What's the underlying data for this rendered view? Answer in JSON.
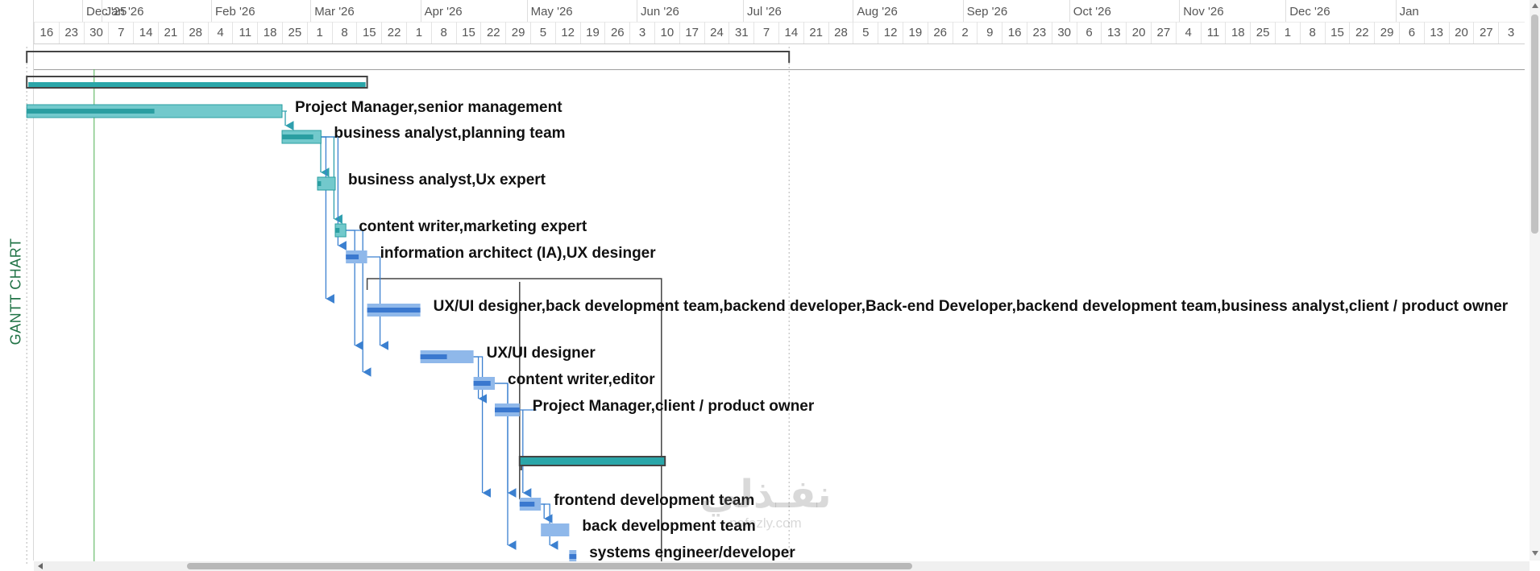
{
  "view": {
    "side_label": "GANTT CHART",
    "colors": {
      "summary_bar": "#2aa6a9",
      "teal_task": "#72c9cc",
      "teal_progress": "#2a9ea1",
      "blue_task": "#8fb8ea",
      "blue_progress": "#3a78cf",
      "link_teal": "#2e9fae",
      "link_blue": "#3b80d0",
      "summary_bracket": "#444444",
      "today_line": "#4caf50",
      "side_label": "#217346"
    }
  },
  "timescale": {
    "months": [
      "Dec '25",
      "Jan '26",
      "Feb '26",
      "Mar '26",
      "Apr '26",
      "May '26",
      "Jun '26",
      "Jul '26",
      "Aug '26",
      "Sep '26",
      "Oct '26",
      "Nov '26",
      "Dec '26",
      "Jan"
    ],
    "days": [
      "16",
      "23",
      "30",
      "7",
      "14",
      "21",
      "28",
      "4",
      "11",
      "18",
      "25",
      "1",
      "8",
      "15",
      "22",
      "1",
      "8",
      "15",
      "22",
      "29",
      "5",
      "12",
      "19",
      "26",
      "3",
      "10",
      "17",
      "24",
      "31",
      "7",
      "14",
      "21",
      "28",
      "5",
      "12",
      "19",
      "26",
      "2",
      "9",
      "16",
      "23",
      "30",
      "6",
      "13",
      "20",
      "27",
      "4",
      "11",
      "18",
      "25",
      "1",
      "8",
      "15",
      "22",
      "29",
      "6",
      "13",
      "20",
      "27",
      "3"
    ]
  },
  "tasks": [
    {
      "id": "summary-project",
      "type": "summary",
      "start": "2025-12-11",
      "end": "2026-03-17",
      "label": ""
    },
    {
      "id": "task-1",
      "type": "task",
      "color": "teal",
      "start": "2025-12-11",
      "end": "2026-02-21",
      "progress": 0.5,
      "label": "Project Manager,senior management"
    },
    {
      "id": "task-2",
      "type": "task",
      "color": "teal",
      "start": "2026-02-21",
      "end": "2026-03-04",
      "progress": 0.8,
      "label": "business analyst,planning team"
    },
    {
      "id": "task-3",
      "type": "task",
      "color": "teal",
      "start": "2026-03-03",
      "end": "2026-03-08",
      "progress": 0.2,
      "label": "business analyst,Ux expert"
    },
    {
      "id": "task-4",
      "type": "task",
      "color": "teal",
      "start": "2026-03-08",
      "end": "2026-03-11",
      "progress": 0.4,
      "label": "content writer,marketing expert"
    },
    {
      "id": "task-5",
      "type": "task",
      "color": "blue",
      "start": "2026-03-11",
      "end": "2026-03-17",
      "progress": 0.6,
      "label": "information architect (IA),UX desinger"
    },
    {
      "id": "task-6",
      "type": "task",
      "color": "blue",
      "start": "2026-03-17",
      "end": "2026-04-01",
      "progress": 1.0,
      "label": "UX/UI designer,back development team,backend developer,Back-end Developer,backend development team,business analyst,client / product owner"
    },
    {
      "id": "task-7",
      "type": "task",
      "color": "blue",
      "start": "2026-04-01",
      "end": "2026-04-16",
      "progress": 0.5,
      "label": "UX/UI designer"
    },
    {
      "id": "task-8",
      "type": "task",
      "color": "blue",
      "start": "2026-04-16",
      "end": "2026-04-22",
      "progress": 0.8,
      "label": "content writer,editor"
    },
    {
      "id": "task-9",
      "type": "task",
      "color": "blue",
      "start": "2026-04-22",
      "end": "2026-04-29",
      "progress": 1.0,
      "label": "Project Manager,client / product owner"
    },
    {
      "id": "summary-development",
      "type": "summary",
      "start": "2026-04-29",
      "end": "2026-06-09",
      "label": ""
    },
    {
      "id": "task-10",
      "type": "task",
      "color": "blue",
      "start": "2026-04-29",
      "end": "2026-05-05",
      "progress": 0.7,
      "label": "frontend development team"
    },
    {
      "id": "task-11",
      "type": "task",
      "color": "blue",
      "start": "2026-05-05",
      "end": "2026-05-13",
      "progress": 0.0,
      "label": "back development team"
    },
    {
      "id": "task-12",
      "type": "task",
      "color": "blue",
      "start": "2026-05-13",
      "end": "2026-05-15",
      "progress": 1.0,
      "label": "systems engineer/developer"
    }
  ],
  "links": [
    {
      "from": "task-1",
      "to": "task-2"
    },
    {
      "from": "task-2",
      "to": "task-3"
    },
    {
      "from": "task-2",
      "to": "task-4"
    },
    {
      "from": "task-2",
      "to": "task-5"
    },
    {
      "from": "task-2",
      "to": "task-6"
    },
    {
      "from": "task-4",
      "to": "task-7"
    },
    {
      "from": "task-5",
      "to": "task-7"
    },
    {
      "from": "task-4",
      "to": "task-8"
    },
    {
      "from": "task-7",
      "to": "task-9"
    },
    {
      "from": "task-7",
      "to": "task-10"
    },
    {
      "from": "task-8",
      "to": "task-10"
    },
    {
      "from": "task-9",
      "to": "task-10"
    },
    {
      "from": "task-10",
      "to": "task-11"
    },
    {
      "from": "task-10",
      "to": "task-12"
    },
    {
      "from": "task-8",
      "to": "task-12"
    }
  ],
  "outline_bracket": {
    "start": "2026-03-17",
    "end": "2026-06-08"
  },
  "today_date": "2025-12-30",
  "project_range": {
    "start": "2025-12-11",
    "end": "2026-07-14"
  },
  "watermark": {
    "logo": "نفـذلي",
    "url": "nafezly.com"
  }
}
